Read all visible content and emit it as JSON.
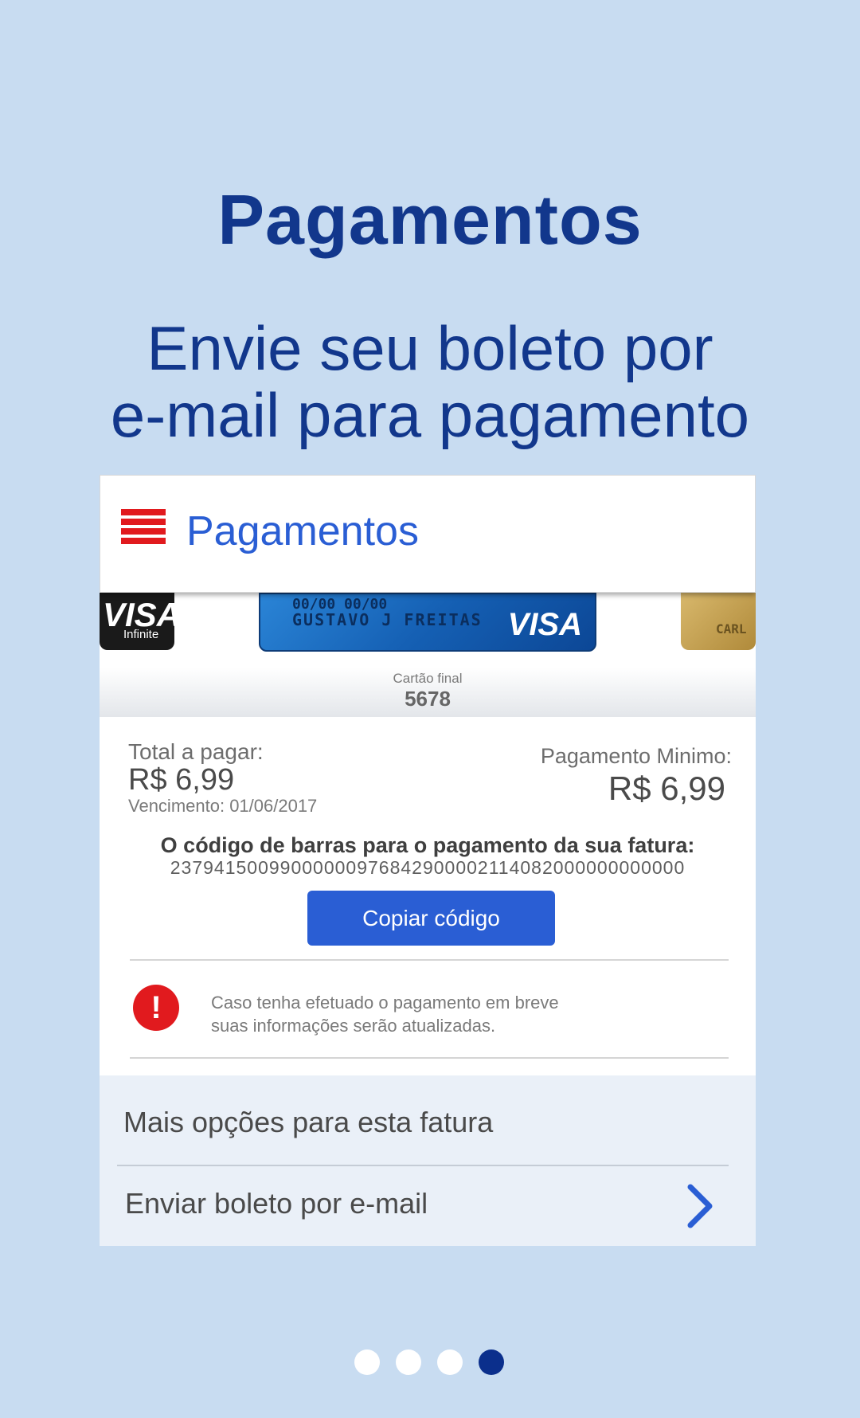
{
  "promo": {
    "headline": "Pagamentos",
    "subline_1": "Envie seu boleto por",
    "subline_2": "e-mail para pagamento"
  },
  "app": {
    "title": "Pagamentos",
    "menu_icon": "hamburger-menu-icon"
  },
  "cards": {
    "left": {
      "brand": "VISA",
      "tier": "Infinite"
    },
    "center": {
      "numbers": "00/00        00/00",
      "holder": "GUSTAVO J FREITAS",
      "brand": "VISA"
    },
    "right": {
      "holder": "CARL"
    },
    "label": "Cartão final",
    "number": "5678"
  },
  "invoice": {
    "total_label": "Total a pagar:",
    "total_value": "R$ 6,99",
    "due": "Vencimento: 01/06/2017",
    "min_label": "Pagamento Minimo:",
    "min_value": "R$ 6,99",
    "barcode_title": "O código de barras para o pagamento da sua fatura:",
    "barcode": "23794150099000000976842900002114082000000000000",
    "copy_button": "Copiar código",
    "alert_symbol": "!",
    "alert_line1": "Caso tenha efetuado o pagamento em breve",
    "alert_line2": "suas informações serão atualizadas."
  },
  "options": {
    "title": "Mais opções para esta fatura",
    "item_label": "Enviar boleto por e-mail"
  },
  "pager": {
    "count": 4,
    "active": 4
  },
  "colors": {
    "background": "#c8dcf1",
    "brand_blue": "#12378c",
    "accent": "#2a5ed4",
    "alert_red": "#e11a1e"
  }
}
